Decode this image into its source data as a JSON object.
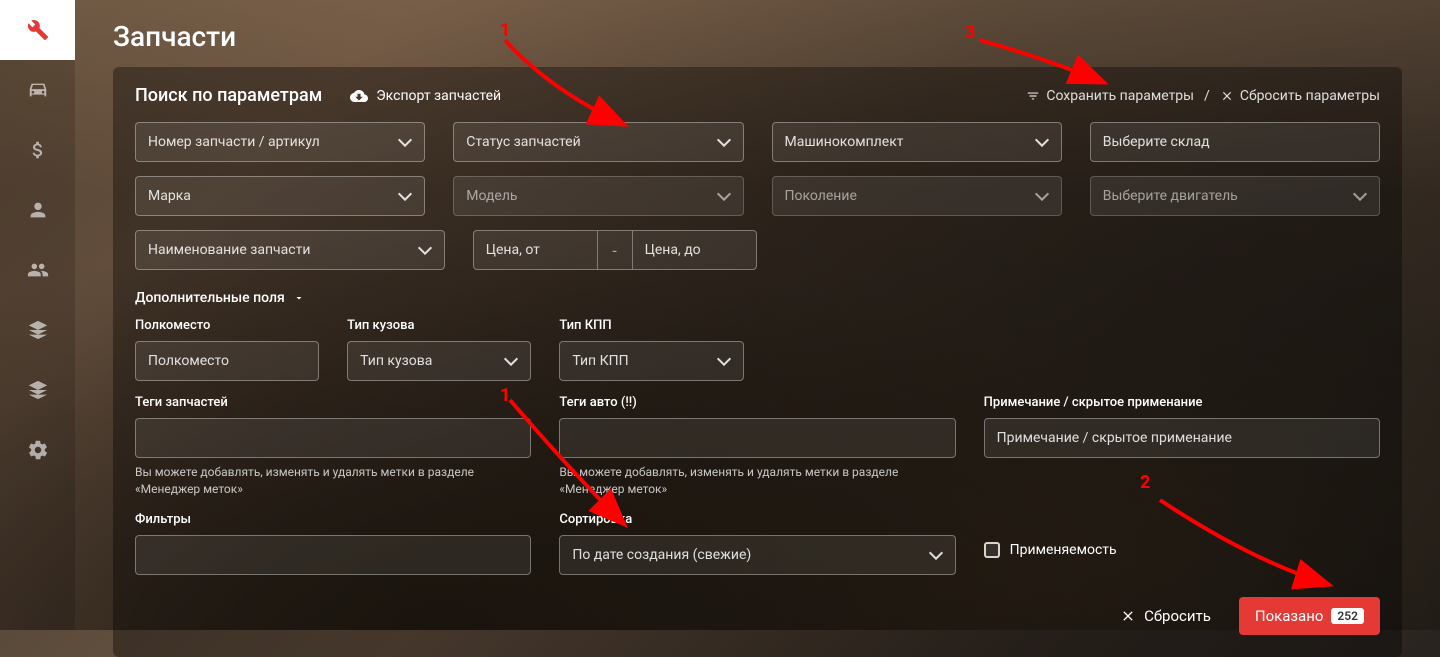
{
  "page_title": "Запчасти",
  "sidebar": {
    "items": [
      "wrench",
      "car",
      "dollar",
      "person",
      "people",
      "stack1",
      "stack2",
      "gear"
    ],
    "active_index": 0
  },
  "panel": {
    "title": "Поиск по параметрам",
    "export": "Экспорт запчастей",
    "save_params": "Сохранить параметры",
    "reset_params": "Сбросить параметры",
    "divider": "/"
  },
  "row1": {
    "part_number": "Номер запчасти / артикул",
    "status": "Статус запчастей",
    "kit": "Машинокомплект",
    "warehouse": "Выберите склад"
  },
  "row2": {
    "brand": "Марка",
    "model": "Модель",
    "generation": "Поколение",
    "engine": "Выберите двигатель"
  },
  "row3": {
    "part_name": "Наименование запчасти",
    "price_from": "Цена, от",
    "price_sep": "-",
    "price_to": "Цена, до"
  },
  "extra_toggle": "Дополнительные поля",
  "extra": {
    "shelf_label": "Полкоместо",
    "shelf_placeholder": "Полкоместо",
    "body_label": "Тип кузова",
    "body_placeholder": "Тип кузова",
    "gearbox_label": "Тип КПП",
    "gearbox_placeholder": "Тип КПП"
  },
  "tags": {
    "parts_label": "Теги запчастей",
    "auto_label": "Теги авто (!!)",
    "note_label": "Примечание / скрытое применание",
    "note_placeholder": "Примечание / скрытое применание",
    "hint": "Вы можете добавлять, изменять и удалять метки в разделе «Менеджер меток»"
  },
  "bottom": {
    "filters_label": "Фильтры",
    "sort_label": "Сортировка",
    "sort_value": "По дате создания (свежие)",
    "applicability": "Применяемость"
  },
  "footer": {
    "reset": "Сбросить",
    "shown": "Показано",
    "count": "252"
  },
  "annotations": {
    "a1": "1",
    "a2": "2",
    "a3": "3",
    "a1b": "1"
  }
}
